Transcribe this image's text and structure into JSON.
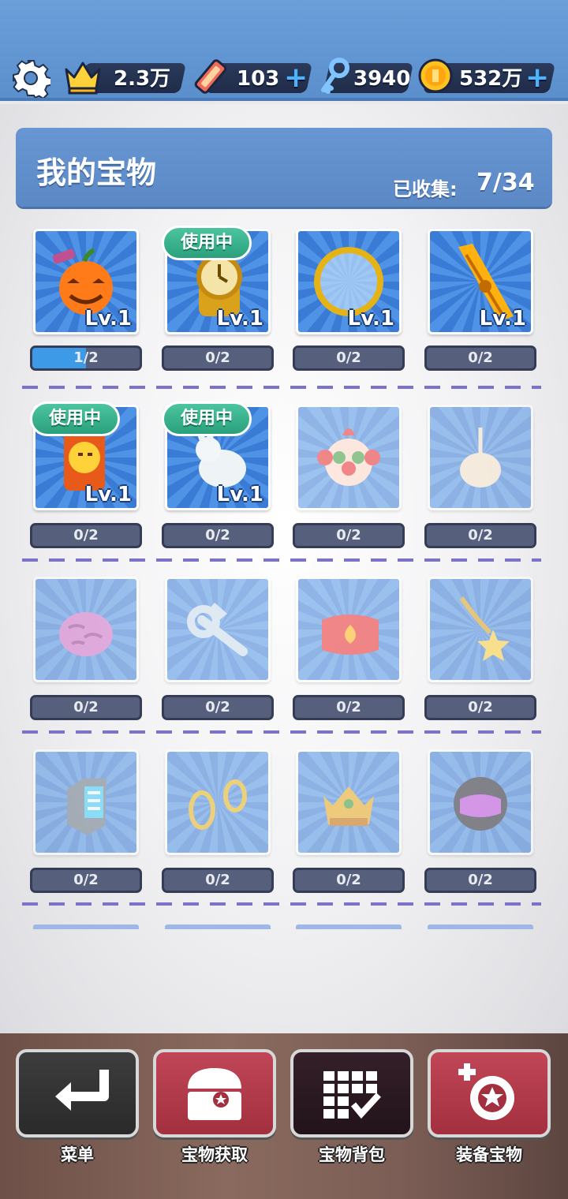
{
  "resources": {
    "crown_value": "2.3万",
    "ticket_value": "103",
    "key_value": "3940",
    "coin_value": "532万",
    "plus": "+"
  },
  "panel": {
    "title": "我的宝物",
    "collected_label": "已收集:",
    "collected_count": "7/34"
  },
  "level_text": "Lv.1",
  "in_use_text": "使用中",
  "items": [
    {
      "icon": "pumpkin-icon",
      "progress": "1/2",
      "fraction": 0.5,
      "owned": true,
      "in_use": false
    },
    {
      "icon": "stopwatch-icon",
      "progress": "0/2",
      "fraction": 0,
      "owned": true,
      "in_use": true
    },
    {
      "icon": "golden-ring-icon",
      "progress": "0/2",
      "fraction": 0,
      "owned": true,
      "in_use": false
    },
    {
      "icon": "golden-scroll-icon",
      "progress": "0/2",
      "fraction": 0,
      "owned": true,
      "in_use": false
    },
    {
      "icon": "lucky-cat-jar-icon",
      "progress": "0/2",
      "fraction": 0,
      "owned": true,
      "in_use": true
    },
    {
      "icon": "white-rabbit-icon",
      "progress": "0/2",
      "fraction": 0,
      "owned": true,
      "in_use": true
    },
    {
      "icon": "clown-mask-icon",
      "progress": "0/2",
      "fraction": 0,
      "owned": false,
      "in_use": false
    },
    {
      "icon": "candle-icon",
      "progress": "0/2",
      "fraction": 0,
      "owned": false,
      "in_use": false
    },
    {
      "icon": "brain-icon",
      "progress": "0/2",
      "fraction": 0,
      "owned": false,
      "in_use": false
    },
    {
      "icon": "wrench-icon",
      "progress": "0/2",
      "fraction": 0,
      "owned": false,
      "in_use": false
    },
    {
      "icon": "fire-hat-icon",
      "progress": "0/2",
      "fraction": 0,
      "owned": false,
      "in_use": false
    },
    {
      "icon": "star-necklace-icon",
      "progress": "0/2",
      "fraction": 0,
      "owned": false,
      "in_use": false
    },
    {
      "icon": "smartwatch-icon",
      "progress": "0/2",
      "fraction": 0,
      "owned": false,
      "in_use": false
    },
    {
      "icon": "earrings-icon",
      "progress": "0/2",
      "fraction": 0,
      "owned": false,
      "in_use": false
    },
    {
      "icon": "crown-icon",
      "progress": "0/2",
      "fraction": 0,
      "owned": false,
      "in_use": false
    },
    {
      "icon": "helmet-icon",
      "progress": "0/2",
      "fraction": 0,
      "owned": false,
      "in_use": false
    }
  ],
  "nav": {
    "menu": "菜单",
    "obtain": "宝物获取",
    "backpack": "宝物背包",
    "equip": "装备宝物"
  },
  "colors": {
    "header": "#5a8fcc",
    "title_bar": "#6796d3",
    "in_use_badge": "#2aa07c",
    "nav_red": "#b03848",
    "nav_dark": "#3a3a3a",
    "nav_active": "#2b1820"
  }
}
